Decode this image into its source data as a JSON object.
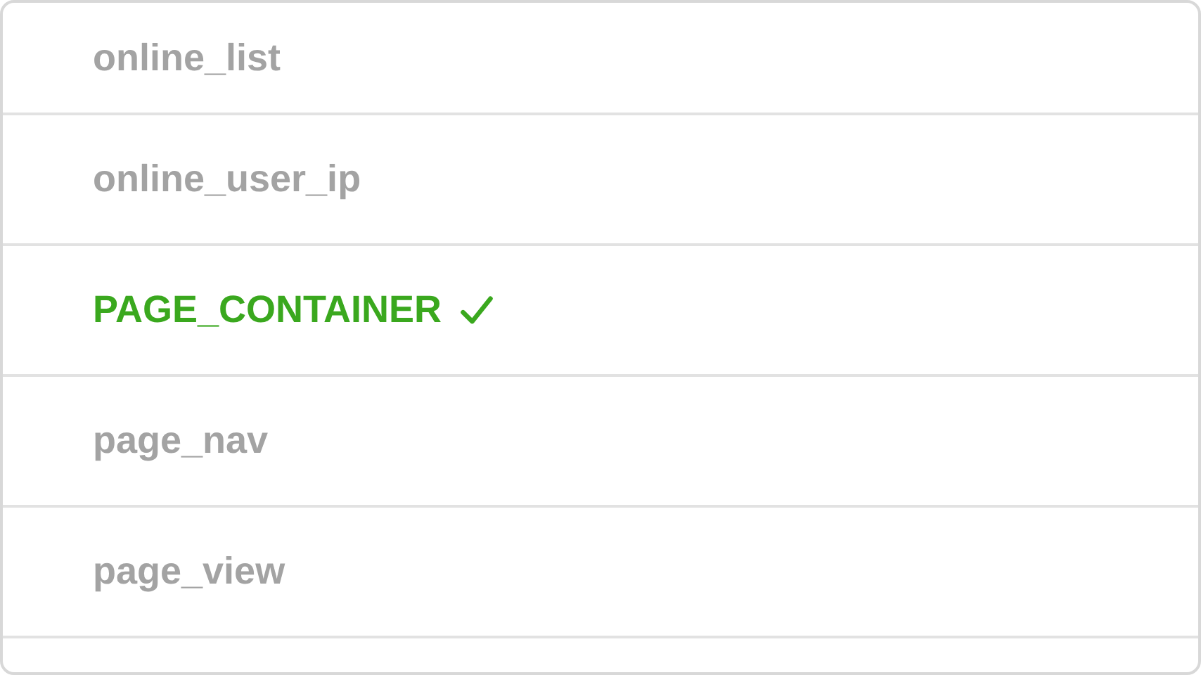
{
  "list": {
    "items": [
      {
        "label": "online_list",
        "selected": false
      },
      {
        "label": "online_user_ip",
        "selected": false
      },
      {
        "label": "PAGE_CONTAINER",
        "selected": true
      },
      {
        "label": "page_nav",
        "selected": false
      },
      {
        "label": "page_view",
        "selected": false
      }
    ]
  }
}
